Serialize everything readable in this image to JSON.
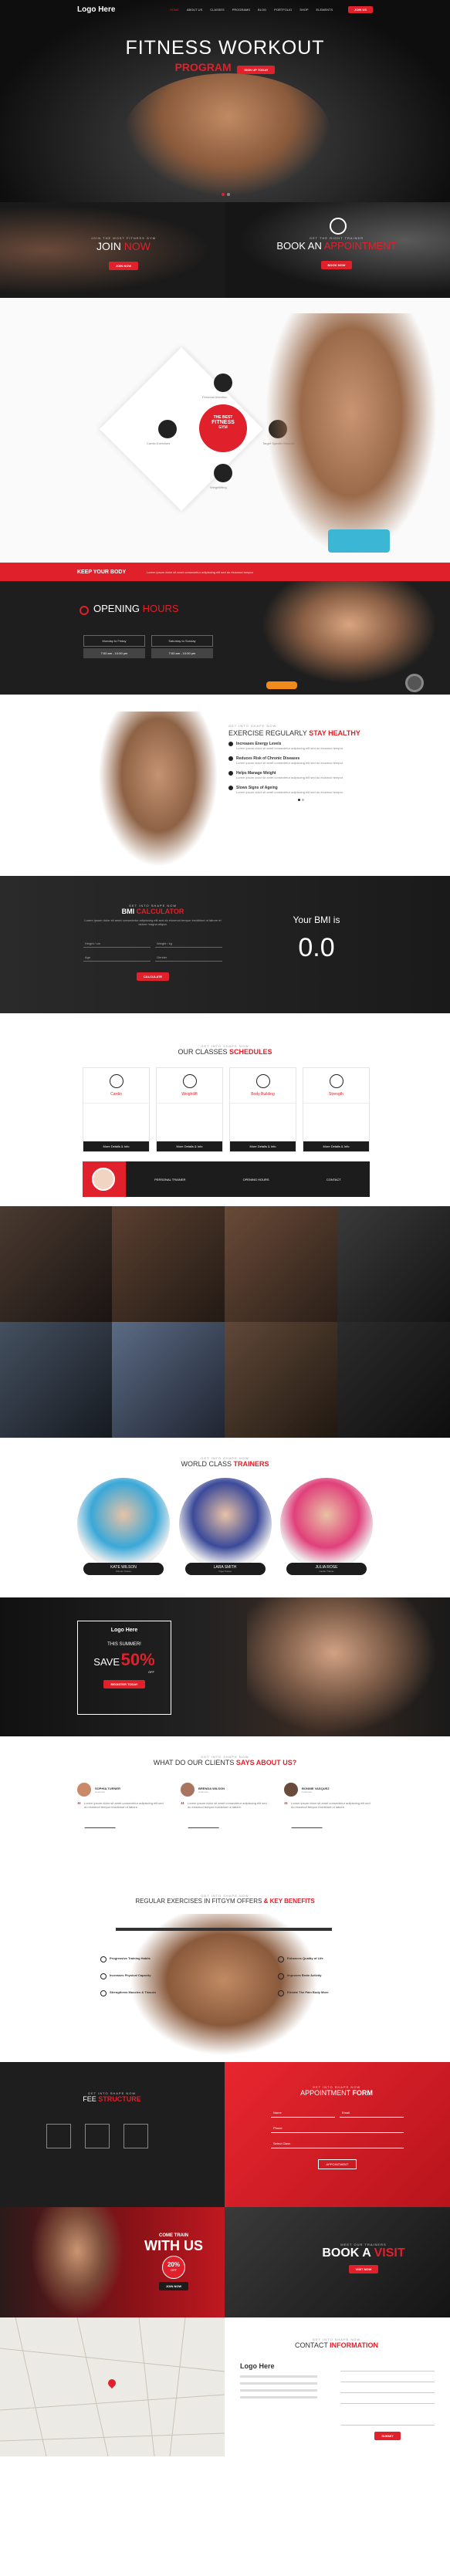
{
  "nav": {
    "logo": "Logo Here",
    "items": [
      "HOME",
      "ABOUT US",
      "CLASSES",
      "PROGRAMS",
      "BLOG",
      "PORTFOLIO",
      "SHOP",
      "ELEMENTS"
    ],
    "cta": "JOIN US"
  },
  "hero": {
    "title1": "FITNESS WORKOUT",
    "title2": "PROGRAM",
    "badge": "SIGN UP TODAY"
  },
  "promo": {
    "left_eyebrow": "JOIN THE MOST FITNESS GYM",
    "left_title_a": "JOIN",
    "left_title_b": "NOW",
    "left_btn": "JOIN NOW",
    "right_eyebrow": "GET THE RIGHT TRAINER",
    "right_title_a": "BOOK AN",
    "right_title_b": "APPOINTMENT",
    "right_btn": "BOOK NOW"
  },
  "wheel": {
    "center1": "THE BEST",
    "center2": "FITNESS",
    "center3": "GYM",
    "items": [
      "Personal Attention",
      "Target Specific Muscles",
      "Weightlifting",
      "Cardio Exercises"
    ]
  },
  "keep": {
    "label": "KEEP YOUR BODY",
    "text": "Lorem ipsum dolor sit amet consectetur adipiscing elit sed do eiusmod tempor"
  },
  "hours": {
    "title_a": "OPENING",
    "title_b": "HOURS",
    "days1": "Monday to Friday",
    "time1": "7:00 am - 10:00 pm",
    "days2": "Saturday to Sunday",
    "time2": "7:00 am - 10:00 pm"
  },
  "exercise": {
    "eyebrow": "GET INTO SHAPE NOW",
    "title_a": "EXERCISE REGULARLY",
    "title_b": "STAY HEALTHY",
    "items": [
      {
        "t": "Increases Energy Levels",
        "d": "Lorem ipsum dolor sit amet consectetur adipiscing elit sed do eiusmod tempor."
      },
      {
        "t": "Reduces Risk of Chronic Diseases",
        "d": "Lorem ipsum dolor sit amet consectetur adipiscing elit sed do eiusmod tempor."
      },
      {
        "t": "Helps Manage Weight",
        "d": "Lorem ipsum dolor sit amet consectetur adipiscing elit sed do eiusmod tempor."
      },
      {
        "t": "Slows Signs of Ageing",
        "d": "Lorem ipsum dolor sit amet consectetur adipiscing elit sed do eiusmod tempor."
      }
    ]
  },
  "bmi": {
    "eyebrow": "GET INTO SHAPE NOW",
    "title_a": "BMI",
    "title_b": "CALCULATOR",
    "text": "Lorem ipsum dolor sit amet consectetur adipiscing elit sed do eiusmod tempor incididunt ut labore et dolore magna aliqua.",
    "f1": "Height / cm",
    "f2": "Weight / kg",
    "f3": "Age",
    "f4": "Gender",
    "btn": "CALCULATE",
    "result_label": "Your BMI is",
    "result": "0.0"
  },
  "schedules": {
    "eyebrow": "GET INTO SHAPE NOW",
    "title_a": "OUR CLASSES",
    "title_b": "SCHEDULES",
    "classes": [
      "Cardio",
      "Weightlift",
      "Body Building",
      "Strength"
    ],
    "btn": "More Details & Info"
  },
  "trainer_strip": {
    "eyebrow": "GET THE TRAINER",
    "a": "PERSONAL TRAINER",
    "b": "OPENING HOURS",
    "c": "CONTACT"
  },
  "trainers": {
    "eyebrow": "GET INTO SHAPE NOW",
    "title_a": "WORLD CLASS",
    "title_b": "TRAINERS",
    "people": [
      {
        "name": "KATE WILSON",
        "role": "Fitness Trainer"
      },
      {
        "name": "LARA SMITH",
        "role": "Yoga Trainer"
      },
      {
        "name": "JULIA ROSE",
        "role": "Cardio Trainer"
      }
    ]
  },
  "sale": {
    "logo": "Logo Here",
    "season": "THIS SUMMER!",
    "save": "SAVE",
    "pct": "50%",
    "off": "OFF",
    "btn": "REGISTER TODAY"
  },
  "testimonials": {
    "eyebrow": "GET INTO SHAPE NOW",
    "title_a": "WHAT DO OUR CLIENTS",
    "title_b": "SAYS ABOUT US?",
    "people": [
      {
        "name": "SOPHIA TURNER",
        "role": "Customer"
      },
      {
        "name": "BRENDA WILSON",
        "role": "Customer"
      },
      {
        "name": "BONNIE VASQUEZ",
        "role": "Customer"
      }
    ],
    "quote": "Lorem ipsum dolor sit amet consectetur adipiscing elit sed do eiusmod tempor incididunt ut labore."
  },
  "benefits": {
    "eyebrow": "GET INTO SHAPE NOW",
    "title_a": "REGULAR EXERCISES IN FITGYM OFFERS",
    "title_b": "& KEY BENEFITS",
    "left": [
      "Progressive Training Habits",
      "Increases Physical Capacity",
      "Strengthens Muscles & Tissues"
    ],
    "right": [
      "Enhances Quality of Life",
      "Improves Brain Activity",
      "Elevate The Pain Body More"
    ]
  },
  "fee": {
    "eyebrow": "GET INTO SHAPE NOW",
    "title_a": "FEE",
    "title_b": "STRUCTURE"
  },
  "appointment": {
    "eyebrow": "GET INTO SHAPE NOW",
    "title_a": "APPOINTMENT",
    "title_b": "FORM",
    "f1": "Name",
    "f2": "Email",
    "f3": "Phone",
    "f4": "Select Class",
    "btn": "APPOINTMENT"
  },
  "join": {
    "eyebrow": "COME TRAIN",
    "title_a": "WITH US",
    "pct": "20%",
    "off": "OFF",
    "btn": "JOIN NOW"
  },
  "visit": {
    "eyebrow": "MEET OUR TRAINERS",
    "title_a": "BOOK A",
    "title_b": "VISIT",
    "btn": "VISIT NOW"
  },
  "contact": {
    "eyebrow": "GET INTO SHAPE NOW",
    "title_a": "CONTACT",
    "title_b": "INFORMATION",
    "logo": "Logo Here",
    "btn": "SUBMIT"
  }
}
